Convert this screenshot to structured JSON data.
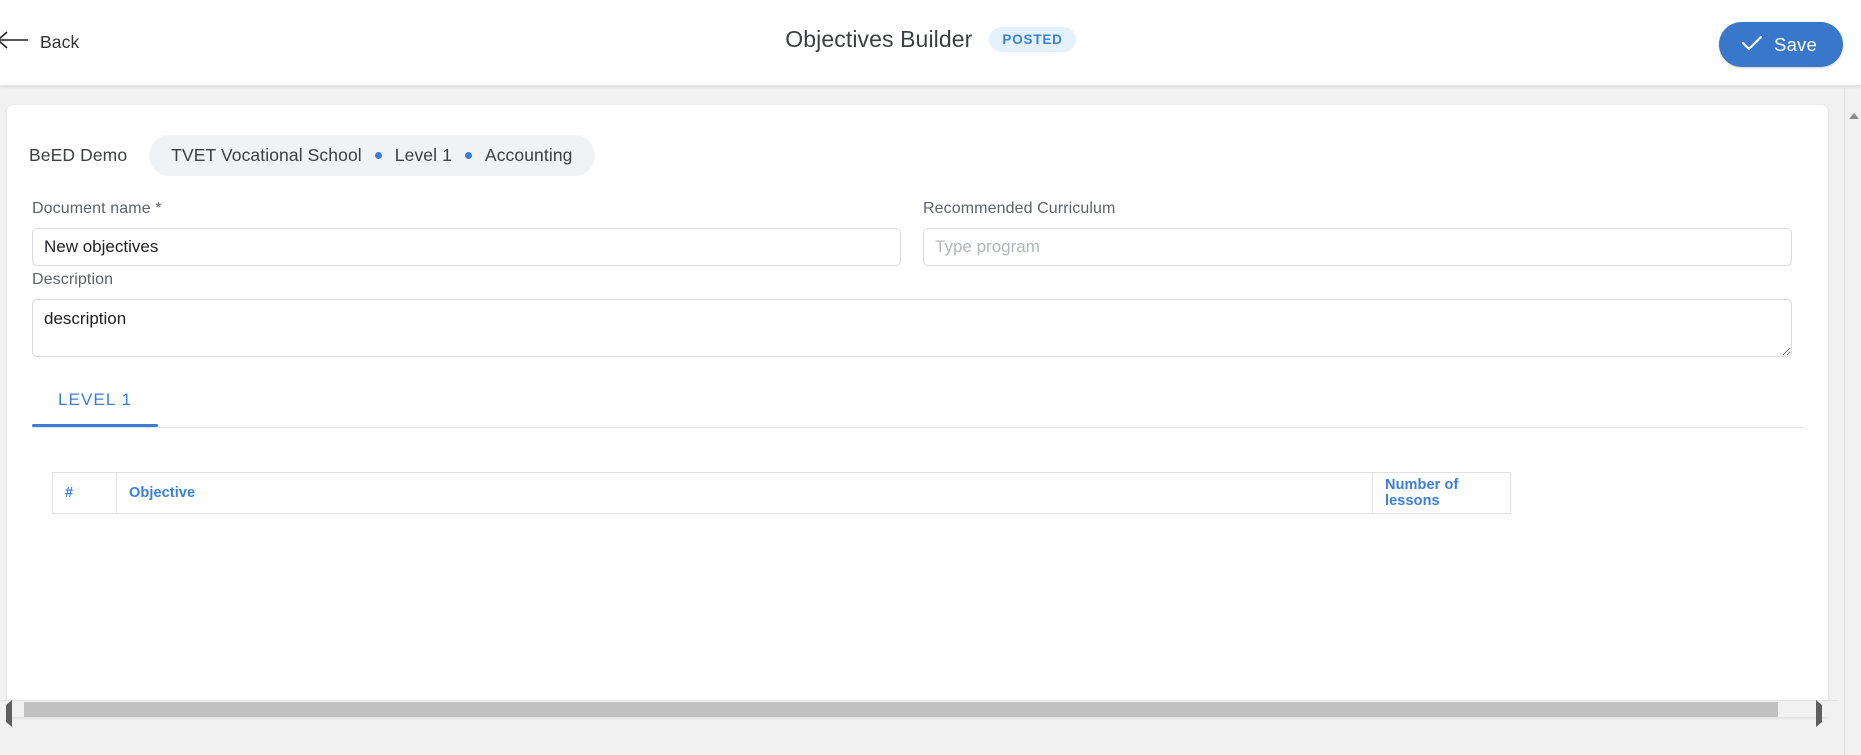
{
  "header": {
    "back_label": "Back",
    "back_icon": "arrow-left-icon",
    "title": "Objectives Builder",
    "status_badge": "POSTED",
    "save_label": "Save",
    "save_icon": "check-icon",
    "accent_color": "#3877c9",
    "badge_bg": "#e3f0fd",
    "badge_text_color": "#3b82d6"
  },
  "breadcrumb": {
    "root": "BeED Demo",
    "items": [
      "TVET Vocational School",
      "Level 1",
      "Accounting"
    ],
    "separator_icon": "dot-separator-icon",
    "separator_color": "#3b7ddd"
  },
  "form": {
    "document_name": {
      "label": "Document name *",
      "value": "New objectives",
      "placeholder": ""
    },
    "recommended_curriculum": {
      "label": "Recommended Curriculum",
      "value": "",
      "placeholder": "Type program"
    },
    "description": {
      "label": "Description",
      "value": "description",
      "placeholder": ""
    }
  },
  "tabs": [
    {
      "label": "LEVEL 1",
      "active": true
    }
  ],
  "table": {
    "columns": [
      "#",
      "Objective",
      "Number of lessons"
    ],
    "rows": [],
    "header_color": "#3b7ddd"
  },
  "scrollbars": {
    "horizontal_left_icon": "triangle-left-icon",
    "horizontal_right_icon": "triangle-right-icon",
    "vertical_up_icon": "triangle-up-icon"
  }
}
